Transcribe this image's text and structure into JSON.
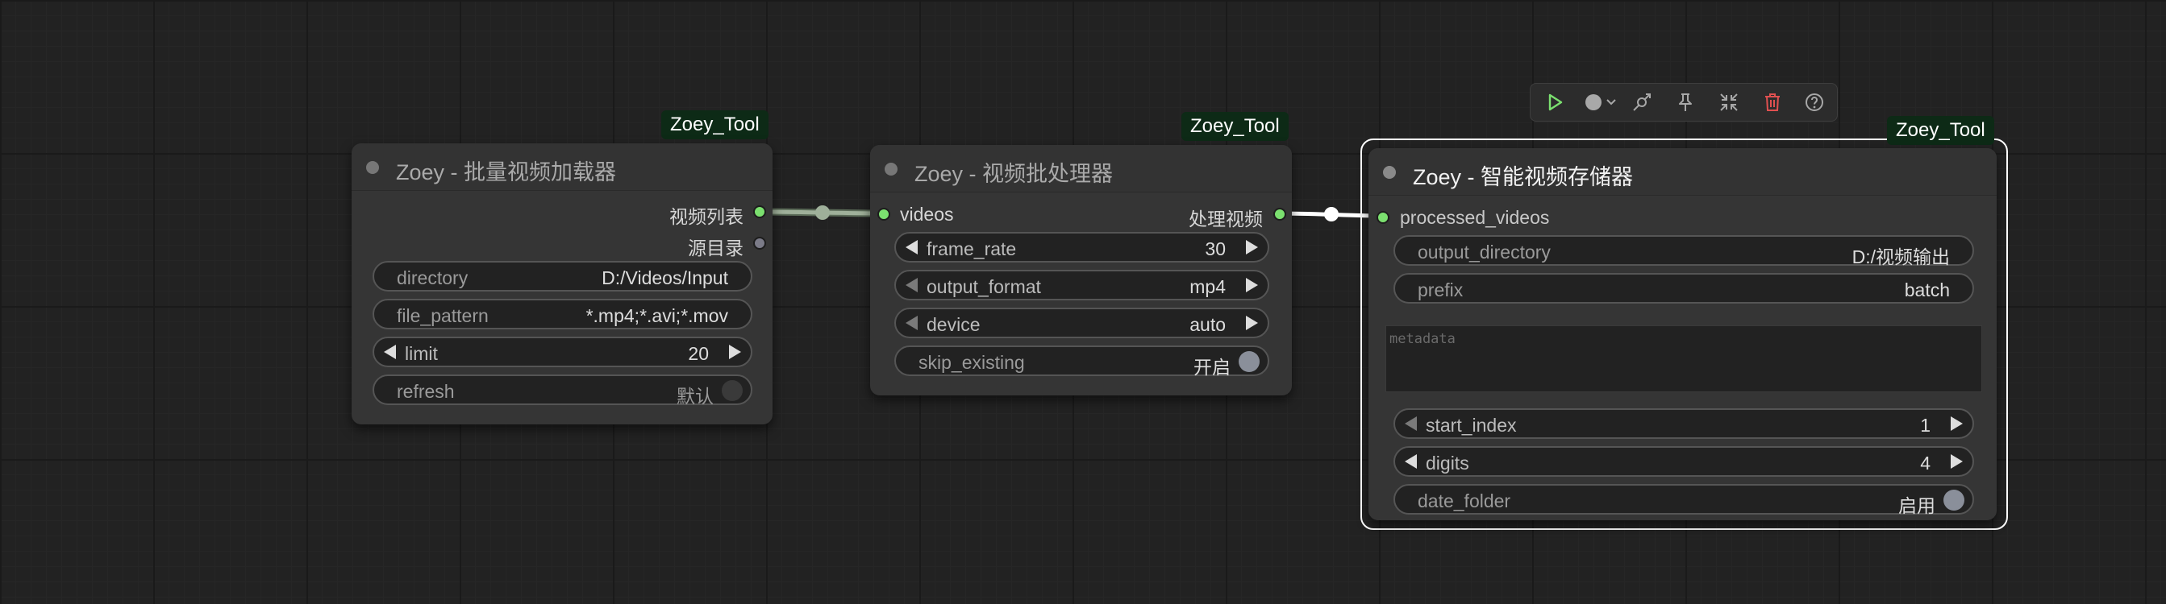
{
  "toolbar": {
    "buttons": [
      "run-icon",
      "color-icon",
      "bypass-icon",
      "pin-icon",
      "collapse-icon",
      "delete-icon",
      "help-icon"
    ]
  },
  "nodes": {
    "loader": {
      "badge": "Zoey_Tool",
      "title": "Zoey - 批量视频加载器",
      "outputs": [
        "视频列表",
        "源目录"
      ],
      "widgets": {
        "directory": {
          "label": "directory",
          "value": "D:/Videos/Input"
        },
        "file_pattern": {
          "label": "file_pattern",
          "value": "*.mp4;*.avi;*.mov"
        },
        "limit": {
          "label": "limit",
          "value": "20"
        },
        "refresh": {
          "label": "refresh",
          "value": "默认",
          "state": "off"
        }
      }
    },
    "processor": {
      "badge": "Zoey_Tool",
      "title": "Zoey - 视频批处理器",
      "input": "videos",
      "output": "处理视频",
      "widgets": {
        "frame_rate": {
          "label": "frame_rate",
          "value": "30"
        },
        "output_format": {
          "label": "output_format",
          "value": "mp4"
        },
        "device": {
          "label": "device",
          "value": "auto"
        },
        "skip_existing": {
          "label": "skip_existing",
          "value": "开启",
          "state": "on"
        }
      }
    },
    "saver": {
      "badge": "Zoey_Tool",
      "title": "Zoey - 智能视频存储器",
      "input": "processed_videos",
      "selected": true,
      "widgets": {
        "output_directory": {
          "label": "output_directory",
          "value": "D:/视频输出"
        },
        "prefix": {
          "label": "prefix",
          "value": "batch"
        },
        "metadata_placeholder": "metadata",
        "start_index": {
          "label": "start_index",
          "value": "1"
        },
        "digits": {
          "label": "digits",
          "value": "4"
        },
        "date_folder": {
          "label": "date_folder",
          "value": "启用",
          "state": "on"
        }
      }
    }
  },
  "colors": {
    "canvas": "#222222",
    "node_body": "#353535",
    "badge_bg": "#0d2a16",
    "slot_connected": "#7be06f",
    "link_1": "#9fb09a",
    "link_2": "#ffffff",
    "delete_icon": "#e05050",
    "run_icon": "#7be06f"
  }
}
